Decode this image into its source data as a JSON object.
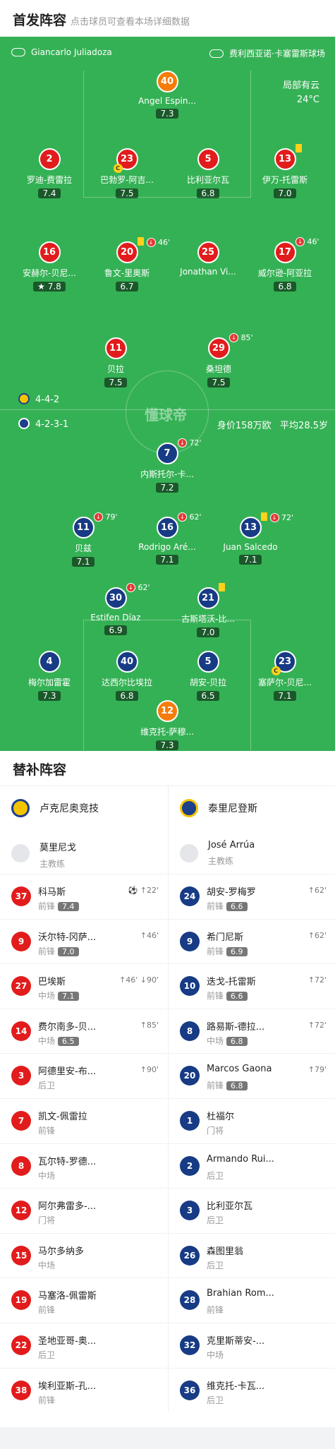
{
  "header": {
    "title": "首发阵容",
    "subtitle": "点击球员可查看本场详细数据"
  },
  "pitch": {
    "referee": "Giancarlo Juliadoza",
    "stadium": "费利西亚诺·卡塞雷斯球场",
    "weather": "局部有云",
    "temperature": "24°C",
    "home_formation": "4-4-2",
    "away_formation": "4-2-3-1",
    "value_label": "身价158万欧",
    "avg_age": "平均28.5岁",
    "watermark": "懂球帝"
  },
  "home_players": [
    {
      "num": "40",
      "name": "Angel Espin...",
      "rating": "7.3",
      "color": "org"
    },
    {
      "num": "2",
      "name": "罗迪-费雷拉",
      "rating": "7.4",
      "color": "red"
    },
    {
      "num": "23",
      "name": "巴勃罗-阿吉...",
      "rating": "7.5",
      "color": "red",
      "captain": "C"
    },
    {
      "num": "5",
      "name": "比利亚尔瓦",
      "rating": "6.8",
      "color": "red"
    },
    {
      "num": "13",
      "name": "伊万-托雷斯",
      "rating": "7.0",
      "color": "red",
      "yellow": true
    },
    {
      "num": "16",
      "name": "安赫尔-贝尼...",
      "rating": "7.8",
      "color": "red",
      "star": true
    },
    {
      "num": "20",
      "name": "鲁文-里奥斯",
      "rating": "6.7",
      "color": "red",
      "yellow": true,
      "sub": "46'"
    },
    {
      "num": "25",
      "name": "Jonathan Vi...",
      "rating": "",
      "color": "red"
    },
    {
      "num": "17",
      "name": "威尔逊-阿亚拉",
      "rating": "6.8",
      "color": "red",
      "sub": "46'"
    },
    {
      "num": "11",
      "name": "贝拉",
      "rating": "7.5",
      "color": "red"
    },
    {
      "num": "29",
      "name": "桑坦德",
      "rating": "7.5",
      "color": "red",
      "sub": "85'",
      "ball": true
    }
  ],
  "away_players": [
    {
      "num": "7",
      "name": "内斯托尔-卡...",
      "rating": "7.2",
      "color": "blu",
      "sub": "72'"
    },
    {
      "num": "11",
      "name": "贝兹",
      "rating": "7.1",
      "color": "blu",
      "sub": "79'"
    },
    {
      "num": "16",
      "name": "Rodrigo Aré...",
      "rating": "7.1",
      "color": "blu",
      "sub": "62'"
    },
    {
      "num": "13",
      "name": "Juan Salcedo",
      "rating": "7.1",
      "color": "blu",
      "yellow": true,
      "sub": "72'"
    },
    {
      "num": "30",
      "name": "Estifen Díaz",
      "rating": "6.9",
      "color": "blu",
      "sub": "62'"
    },
    {
      "num": "21",
      "name": "古斯塔沃-比...",
      "rating": "7.0",
      "color": "blu",
      "yellow": true
    },
    {
      "num": "4",
      "name": "梅尔加雷霍",
      "rating": "7.3",
      "color": "blu"
    },
    {
      "num": "40",
      "name": "达西尔比埃拉",
      "rating": "6.8",
      "color": "blu"
    },
    {
      "num": "5",
      "name": "胡安-贝拉",
      "rating": "6.5",
      "color": "blu"
    },
    {
      "num": "23",
      "name": "塞萨尔-贝尼...",
      "rating": "7.1",
      "color": "blu",
      "captain": "C"
    },
    {
      "num": "12",
      "name": "维克托-萨穆...",
      "rating": "7.3",
      "color": "org"
    }
  ],
  "subs": {
    "title": "替补阵容",
    "home": {
      "team": "卢克尼奥竞技",
      "coach": "莫里尼戈",
      "coach_role": "主教练",
      "players": [
        {
          "num": "37",
          "name": "科马斯",
          "pos": "前锋",
          "rating": "7.4",
          "icons": "⚽ ↑22'"
        },
        {
          "num": "9",
          "name": "沃尔特-冈萨...",
          "pos": "前锋",
          "rating": "7.0",
          "icons": "↑46'"
        },
        {
          "num": "27",
          "name": "巴埃斯",
          "pos": "中场",
          "rating": "7.1",
          "icons": "↑46' ↓90'"
        },
        {
          "num": "14",
          "name": "费尔南多-贝...",
          "pos": "中场",
          "rating": "6.5",
          "icons": "↑85'"
        },
        {
          "num": "3",
          "name": "阿德里安-布...",
          "pos": "后卫",
          "rating": "",
          "icons": "↑90'"
        },
        {
          "num": "7",
          "name": "凯文-佩雷拉",
          "pos": "前锋",
          "rating": "",
          "icons": ""
        },
        {
          "num": "8",
          "name": "瓦尔特-罗德...",
          "pos": "中场",
          "rating": "",
          "icons": ""
        },
        {
          "num": "12",
          "name": "阿尔弗雷多-...",
          "pos": "门将",
          "rating": "",
          "icons": ""
        },
        {
          "num": "15",
          "name": "马尔多纳多",
          "pos": "中场",
          "rating": "",
          "icons": ""
        },
        {
          "num": "19",
          "name": "马塞洛-佩雷斯",
          "pos": "前锋",
          "rating": "",
          "icons": ""
        },
        {
          "num": "22",
          "name": "圣地亚哥-奥...",
          "pos": "后卫",
          "rating": "",
          "icons": ""
        },
        {
          "num": "38",
          "name": "埃利亚斯-孔...",
          "pos": "前锋",
          "rating": "",
          "icons": ""
        }
      ]
    },
    "away": {
      "team": "泰里尼登斯",
      "coach": "José Arrúa",
      "coach_role": "主教练",
      "players": [
        {
          "num": "24",
          "name": "胡安-罗梅罗",
          "pos": "前锋",
          "rating": "6.6",
          "icons": "↑62'"
        },
        {
          "num": "9",
          "name": "希门尼斯",
          "pos": "前锋",
          "rating": "6.9",
          "icons": "↑62'"
        },
        {
          "num": "10",
          "name": "迭戈-托雷斯",
          "pos": "前锋",
          "rating": "6.6",
          "icons": "↑72'"
        },
        {
          "num": "8",
          "name": "路易斯-德拉...",
          "pos": "中场",
          "rating": "6.8",
          "icons": "↑72'"
        },
        {
          "num": "20",
          "name": "Marcos Gaona",
          "pos": "前锋",
          "rating": "6.8",
          "icons": "↑79'"
        },
        {
          "num": "1",
          "name": "杜福尔",
          "pos": "门将",
          "rating": "",
          "icons": ""
        },
        {
          "num": "2",
          "name": "Armando Rui...",
          "pos": "后卫",
          "rating": "",
          "icons": ""
        },
        {
          "num": "3",
          "name": "比利亚尔瓦",
          "pos": "后卫",
          "rating": "",
          "icons": ""
        },
        {
          "num": "26",
          "name": "森图里翁",
          "pos": "后卫",
          "rating": "",
          "icons": ""
        },
        {
          "num": "28",
          "name": "Brahian Rom...",
          "pos": "前锋",
          "rating": "",
          "icons": ""
        },
        {
          "num": "32",
          "name": "克里斯蒂安-...",
          "pos": "中场",
          "rating": "",
          "icons": ""
        },
        {
          "num": "36",
          "name": "维克托-卡瓦...",
          "pos": "后卫",
          "rating": "",
          "icons": ""
        }
      ]
    }
  }
}
